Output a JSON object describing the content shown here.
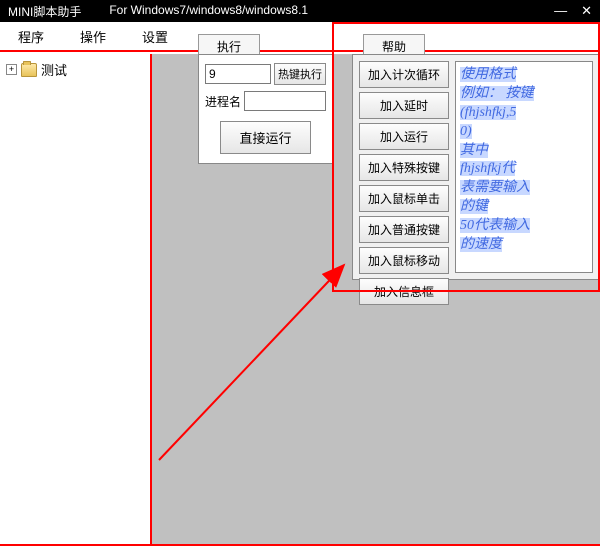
{
  "title": {
    "app": "MINI脚本助手",
    "suffix": "For Windows7/windows8/windows8.1"
  },
  "windowControls": {
    "min": "—",
    "close": "✕"
  },
  "menu": {
    "program": "程序",
    "operate": "操作",
    "settings": "设置"
  },
  "execTab": {
    "label": "执行"
  },
  "exec": {
    "inputValue": "9",
    "hotkeyBtn": "热键执行",
    "processLabel": "进程名",
    "directRun": "直接运行"
  },
  "helpTab": {
    "label": "帮助"
  },
  "helpButtons": {
    "b1": "加入计次循环",
    "b2": "加入延时",
    "b3": "加入运行",
    "b4": "加入特殊按键",
    "b5": "加入鼠标单击",
    "b6": "加入普通按键",
    "b7": "加入鼠标移动",
    "b8": "加入信息框"
  },
  "helpText": {
    "l1": "使用格式",
    "l2": "例如： 按键",
    "l3": "(fhjshfkj,5",
    "l4": "0)",
    "l5": "其中",
    "l6": "fhjshfkj代",
    "l7": "表需要输入",
    "l8": "的键",
    "l9": "50代表输入",
    "l10": "的速度"
  },
  "tree": {
    "expand": "+",
    "root": "测试"
  }
}
